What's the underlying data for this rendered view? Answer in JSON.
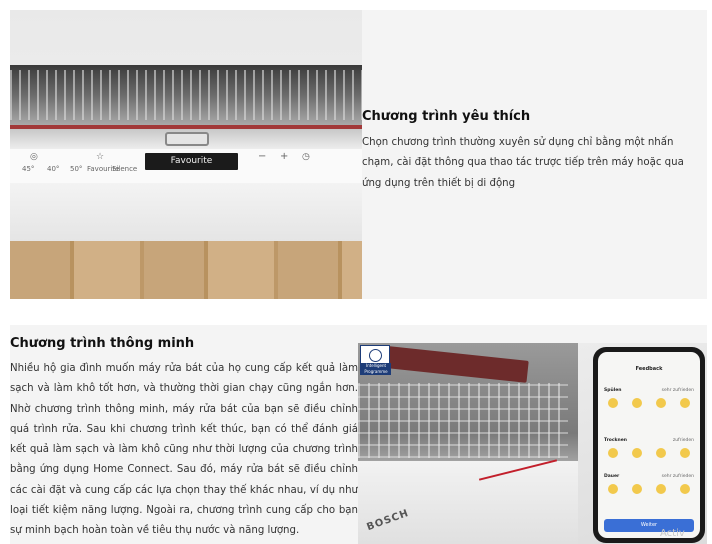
{
  "section1": {
    "title": "Chương trình yêu thích",
    "description": "Chọn chương trình thường xuyên sử dụng chỉ bằng một nhấn chạm, cài đặt thông qua thao tác trược tiếp trên máy hoặc qua ứng dụng trên thiết bị di động",
    "panel_display": "Favourite",
    "panel_labels": [
      "45°",
      "40°",
      "50°",
      "Favourite",
      "Silence"
    ],
    "panel_controls": [
      "−",
      "+"
    ]
  },
  "section2": {
    "title": "Chương trình thông minh",
    "description": "Nhiều hộ gia đình muốn máy rửa bát của họ cung cấp kết quả làm sạch và làm khô tốt hơn, và thường thời gian chạy cũng ngắn hơn. Nhờ chương trình thông minh, máy rửa bát của bạn sẽ điều chỉnh quá trình rửa. Sau khi chương trình kết thúc, bạn có thể đánh giá kết quả làm sạch và làm khô cũng như thời lượng của chương trình bằng ứng dụng Home Connect. Sau đó, máy rửa bát sẽ điều chỉnh các cài đặt và cung cấp các lựa chọn thay thế khác nhau, ví dụ như loại tiết kiệm năng lượng. Ngoài ra, chương trình cung cấp cho bạn sự minh bạch hoàn toàn về tiêu thụ nước và năng lượng.",
    "badge_label": "Intelligent Programme",
    "brand": "BOSCH",
    "phone": {
      "title": "Feedback",
      "rows": [
        {
          "label": "Spülen",
          "rating": "sehr zufrieden"
        },
        {
          "label": "Trocknen",
          "rating": "zufrieden"
        },
        {
          "label": "Dauer",
          "rating": "sehr zufrieden"
        }
      ],
      "button": "Weiter"
    }
  },
  "watermark": "Activ"
}
